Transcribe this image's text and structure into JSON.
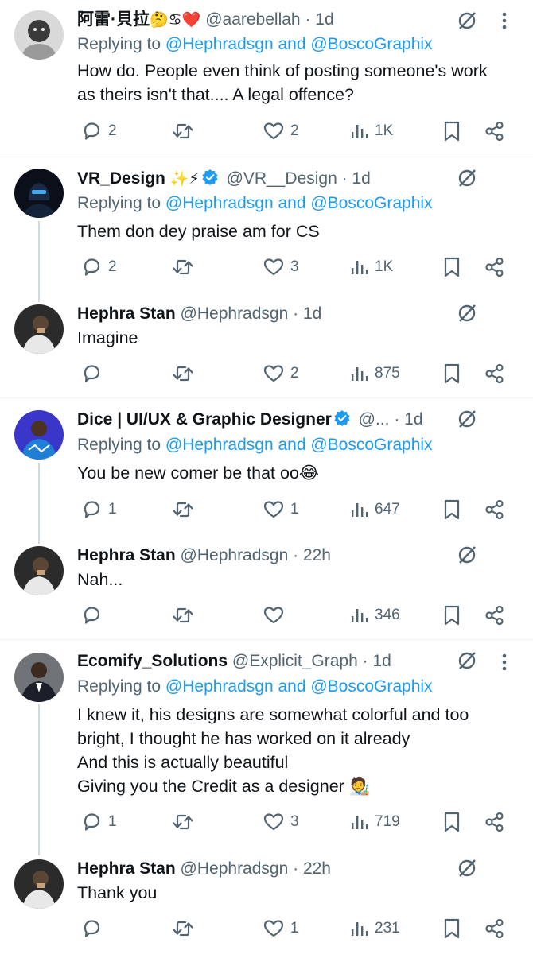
{
  "tweets": [
    {
      "name": "阿雷·貝拉",
      "name_emojis": "🤔♋❤️",
      "handle": "@aarebellah",
      "time": "· 1d",
      "replying_prefix": "Replying to",
      "replying_users": "@Hephradsgn and @BoscoGraphix",
      "body": [
        "How do. People even think of posting someone's work",
        "as theirs isn't that.... A legal offence?"
      ],
      "replies": "2",
      "retweets": "",
      "likes": "2",
      "views": "1K"
    },
    {
      "name": "VR_Design",
      "name_emojis": "✨⚡",
      "verified": true,
      "handle": "@VR__Design",
      "time": "· 1d",
      "replying_prefix": "Replying to",
      "replying_users": "@Hephradsgn and @BoscoGraphix",
      "body": [
        "Them don dey praise am for CS"
      ],
      "replies": "2",
      "retweets": "",
      "likes": "3",
      "views": "1K"
    },
    {
      "name": "Hephra Stan",
      "handle": "@Hephradsgn",
      "time": "· 1d",
      "body": [
        "Imagine"
      ],
      "replies": "",
      "retweets": "",
      "likes": "2",
      "views": "875"
    },
    {
      "name": "Dice | UI/UX & Graphic Designer",
      "verified": true,
      "handle": "@...",
      "time": "· 1d",
      "replying_prefix": "Replying to",
      "replying_users": "@Hephradsgn and @BoscoGraphix",
      "body": [
        "You be new comer be that oo😂"
      ],
      "replies": "1",
      "retweets": "",
      "likes": "1",
      "views": "647"
    },
    {
      "name": "Hephra Stan",
      "handle": "@Hephradsgn",
      "time": "· 22h",
      "body": [
        "Nah..."
      ],
      "replies": "",
      "retweets": "",
      "likes": "",
      "views": "346"
    },
    {
      "name": "Ecomify_Solutions",
      "handle": "@Explicit_Graph",
      "time": "· 1d",
      "replying_prefix": "Replying to",
      "replying_users": "@Hephradsgn and @BoscoGraphix",
      "body": [
        "I knew it, his designs are somewhat colorful and too",
        "bright, I thought he has worked on it already",
        "And this is actually beautiful",
        "Giving you the Credit as a designer 🧑‍🎨"
      ],
      "replies": "1",
      "retweets": "",
      "likes": "3",
      "views": "719"
    },
    {
      "name": "Hephra Stan",
      "handle": "@Hephradsgn",
      "time": "· 22h",
      "body": [
        "Thank you"
      ],
      "replies": "",
      "retweets": "",
      "likes": "1",
      "views": "231"
    }
  ],
  "icons": {
    "reply": "reply-icon",
    "retweet": "retweet-icon",
    "like": "heart-icon",
    "views": "views-icon",
    "bookmark": "bookmark-icon",
    "share": "share-icon",
    "mute": "mute-icon",
    "more": "more-icon",
    "verified": "verified-badge-icon"
  },
  "colors": {
    "text": "#0f1419",
    "secondary": "#536471",
    "mention": "#1d9bf0",
    "verified": "#1d9bf0",
    "thread_line": "#cfd9de"
  }
}
